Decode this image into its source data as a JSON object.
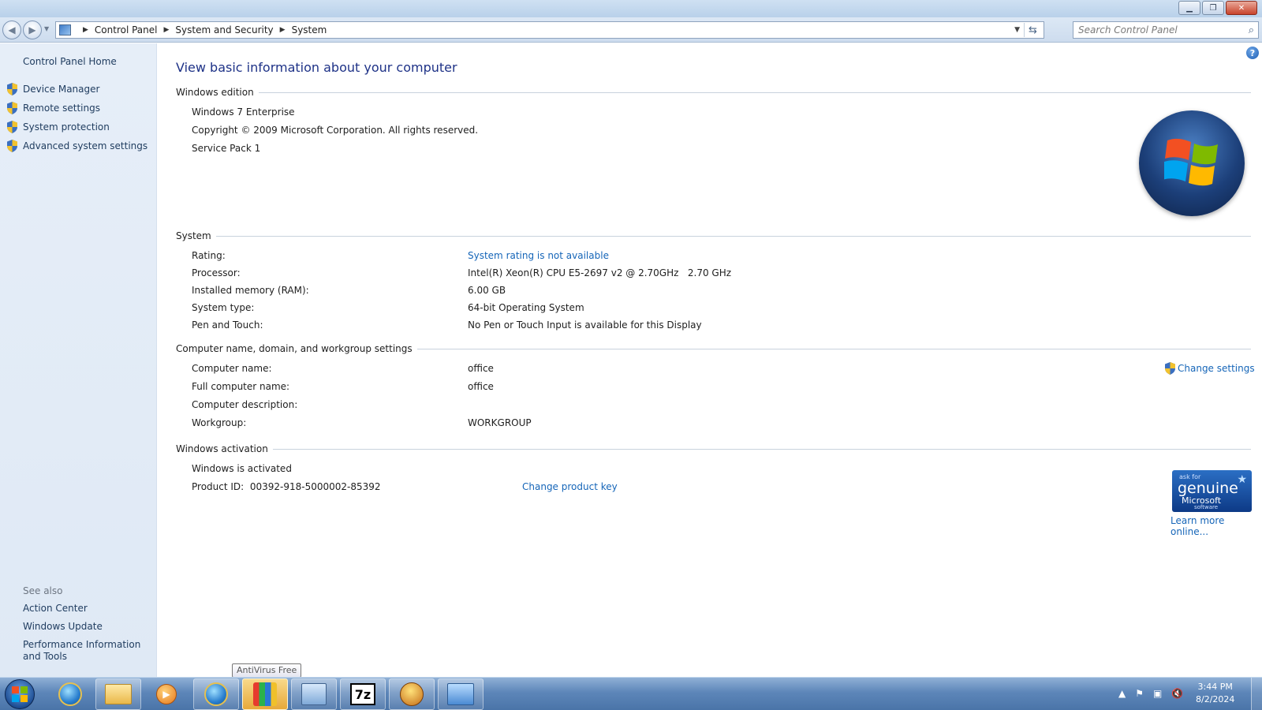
{
  "window": {
    "minimize": "▁",
    "maximize": "❐",
    "close": "✕"
  },
  "address": {
    "crumbs": [
      "Control Panel",
      "System and Security",
      "System"
    ],
    "search_placeholder": "Search Control Panel"
  },
  "sidebar": {
    "home": "Control Panel Home",
    "tasks": [
      "Device Manager",
      "Remote settings",
      "System protection",
      "Advanced system settings"
    ],
    "see_also_title": "See also",
    "see_also": [
      "Action Center",
      "Windows Update",
      "Performance Information and Tools"
    ]
  },
  "main": {
    "title": "View basic information about your computer",
    "edition": {
      "heading": "Windows edition",
      "name": "Windows 7 Enterprise",
      "copyright": "Copyright © 2009 Microsoft Corporation.  All rights reserved.",
      "service_pack": "Service Pack 1"
    },
    "system": {
      "heading": "System",
      "rows": [
        {
          "label": "Rating:",
          "value": "System rating is not available"
        },
        {
          "label": "Processor:",
          "value": "Intel(R) Xeon(R) CPU E5-2697 v2 @ 2.70GHz   2.70 GHz"
        },
        {
          "label": "Installed memory (RAM):",
          "value": "6.00 GB"
        },
        {
          "label": "System type:",
          "value": "64-bit Operating System"
        },
        {
          "label": "Pen and Touch:",
          "value": "No Pen or Touch Input is available for this Display"
        }
      ]
    },
    "computer": {
      "heading": "Computer name, domain, and workgroup settings",
      "change_settings": "Change settings",
      "rows": [
        {
          "label": "Computer name:",
          "value": "office"
        },
        {
          "label": "Full computer name:",
          "value": "office"
        },
        {
          "label": "Computer description:",
          "value": ""
        },
        {
          "label": "Workgroup:",
          "value": "WORKGROUP"
        }
      ]
    },
    "activation": {
      "heading": "Windows activation",
      "status": "Windows is activated",
      "product_id": "Product ID:  00392-918-5000002-85392",
      "change_key": "Change product key",
      "genuine": {
        "line1": "ask for",
        "line2": "genuine",
        "line3": "Microsoft",
        "line4": "software"
      },
      "learn_more": "Learn more online..."
    }
  },
  "tooltip": "AntiVirus Free",
  "taskbar": {
    "time": "3:44 PM",
    "date": "8/2/2024"
  }
}
